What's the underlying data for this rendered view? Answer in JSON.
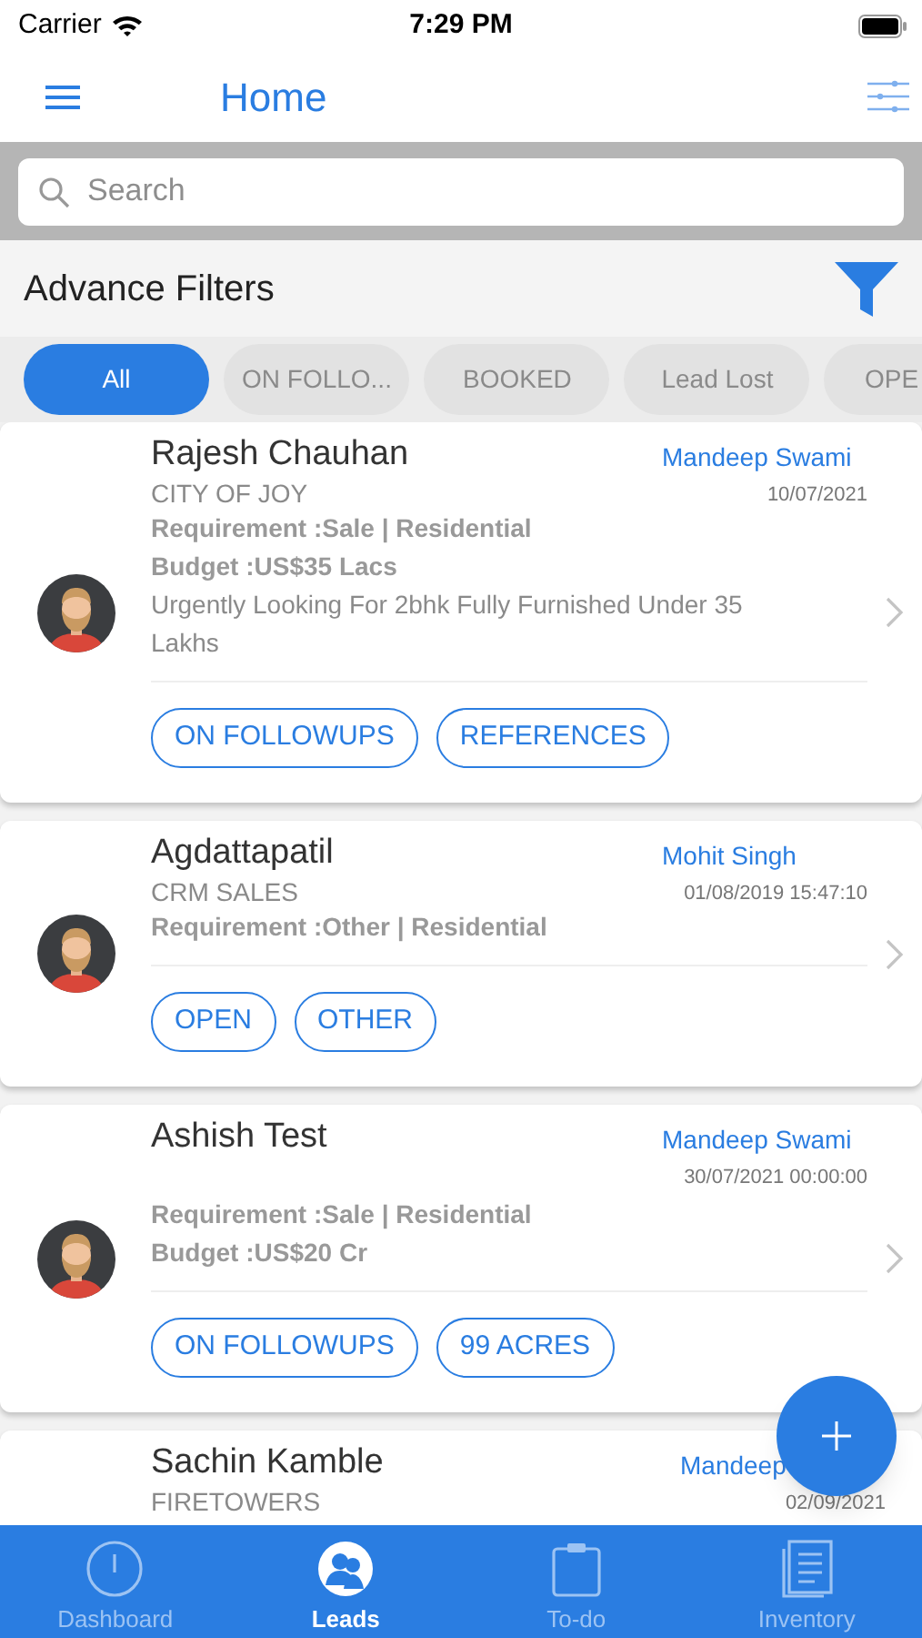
{
  "status_bar": {
    "carrier": "Carrier",
    "time": "7:29 PM"
  },
  "nav": {
    "title": "Home"
  },
  "search": {
    "placeholder": "Search"
  },
  "filters": {
    "title": "Advance Filters"
  },
  "chips": [
    {
      "label": "All",
      "selected": true
    },
    {
      "label": "ON FOLLO...",
      "selected": false
    },
    {
      "label": "BOOKED",
      "selected": false
    },
    {
      "label": "Lead Lost",
      "selected": false
    },
    {
      "label": "OPE",
      "selected": false
    }
  ],
  "leads": [
    {
      "avatar": true,
      "name": "Rajesh Chauhan",
      "assignee": "Mandeep Swami",
      "project": "CITY OF JOY",
      "date": "10/07/2021",
      "lines": [
        "Requirement :Sale | Residential",
        "Budget :US$35 Lacs",
        "Urgently Looking For 2bhk Fully Furnished Under 35 Lakhs"
      ],
      "tags": [
        "ON FOLLOWUPS",
        "REFERENCES"
      ]
    },
    {
      "avatar": true,
      "name": "Agdattapatil",
      "assignee": "Mohit Singh",
      "project": "CRM SALES",
      "date": "01/08/2019 15:47:10",
      "lines": [
        "Requirement :Other | Residential"
      ],
      "tags": [
        "OPEN",
        "OTHER"
      ]
    },
    {
      "avatar": true,
      "name": "Ashish Test",
      "assignee": "Mandeep Swami",
      "date": "30/07/2021 00:00:00",
      "lines": [
        "Requirement :Sale | Residential",
        "Budget :US$20 Cr"
      ],
      "tags": [
        "ON FOLLOWUPS",
        "99 ACRES"
      ]
    },
    {
      "name": "Sachin Kamble",
      "assignee": "Mandeep",
      "project": "FIRETOWERS",
      "date": "02/09/2021"
    }
  ],
  "tab_bar": [
    {
      "kind": "dashboard",
      "label": "Dashboard",
      "selected": false
    },
    {
      "kind": "leads",
      "label": "Leads",
      "selected": true
    },
    {
      "kind": "todo",
      "label": "To-do",
      "selected": false
    },
    {
      "kind": "inventory",
      "label": "Inventory",
      "selected": false
    }
  ]
}
